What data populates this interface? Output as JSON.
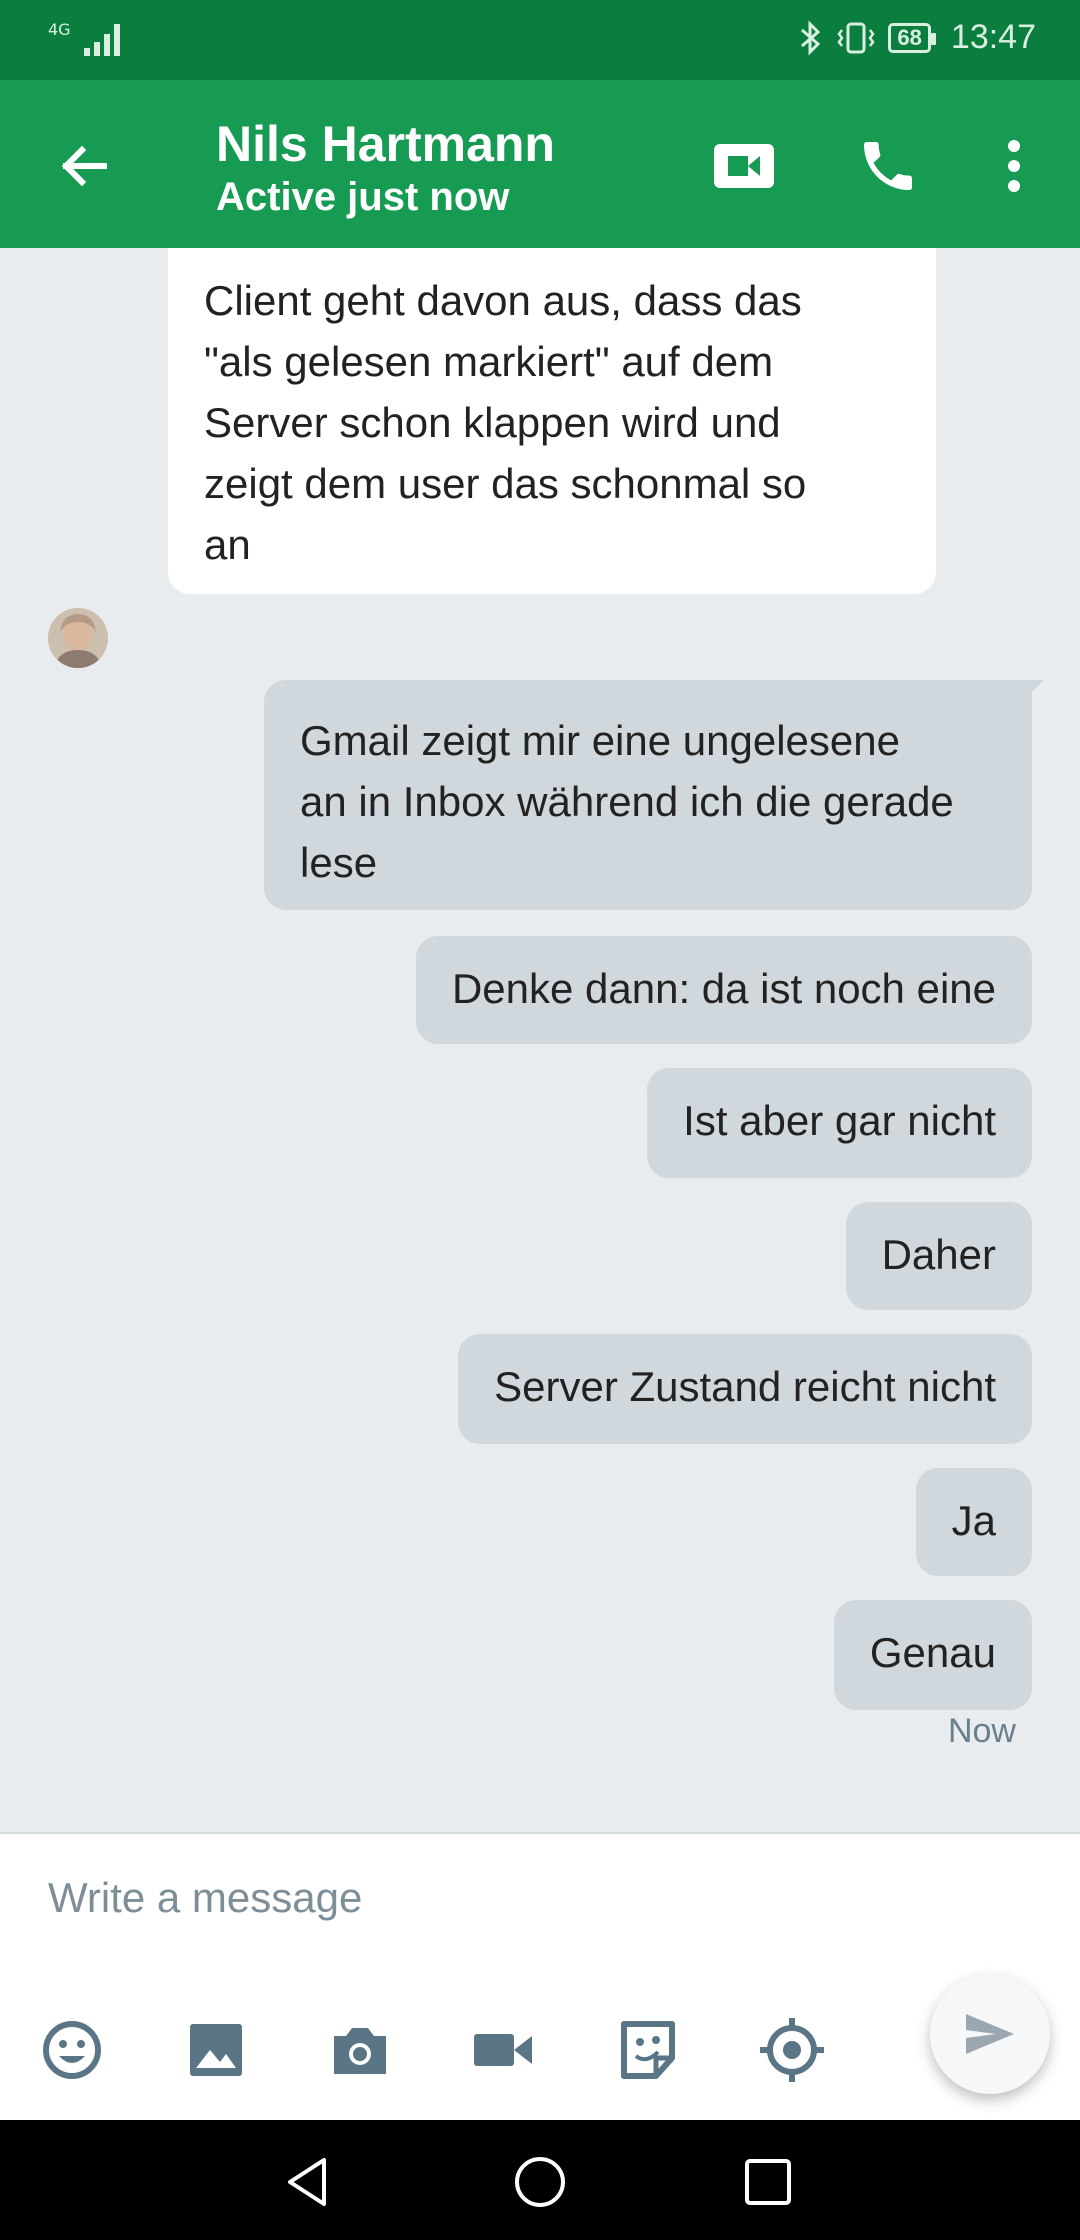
{
  "status_bar": {
    "network": "4G",
    "battery": "68",
    "time": "13:47"
  },
  "header": {
    "contact_name": "Nils Hartmann",
    "presence": "Active just now"
  },
  "messages": [
    {
      "direction": "incoming",
      "lines": [
        "Client geht davon aus, dass das",
        "\"als gelesen markiert\" auf dem",
        "Server schon klappen wird und",
        "zeigt dem user das schonmal so",
        "an"
      ]
    },
    {
      "direction": "outgoing",
      "lines": [
        "Gmail zeigt mir eine ungelesene",
        "an in Inbox während ich die gerade",
        "lese"
      ]
    },
    {
      "direction": "outgoing",
      "text": "Denke dann: da ist noch eine"
    },
    {
      "direction": "outgoing",
      "text": "Ist aber gar nicht"
    },
    {
      "direction": "outgoing",
      "text": "Daher"
    },
    {
      "direction": "outgoing",
      "text": "Server Zustand reicht nicht"
    },
    {
      "direction": "outgoing",
      "text": "Ja"
    },
    {
      "direction": "outgoing",
      "text": "Genau"
    }
  ],
  "last_timestamp": "Now",
  "composer": {
    "placeholder": "Write a message",
    "tools": [
      "emoji-icon",
      "gallery-icon",
      "camera-icon",
      "video-icon",
      "sticker-icon",
      "location-icon"
    ]
  },
  "colors": {
    "status_bar": "#0b7d3e",
    "app_bar": "#179b52",
    "chat_bg": "#e8ecef",
    "outgoing_bubble": "#d0d8de",
    "incoming_bubble": "#ffffff",
    "icon_slate": "#5a7585"
  }
}
